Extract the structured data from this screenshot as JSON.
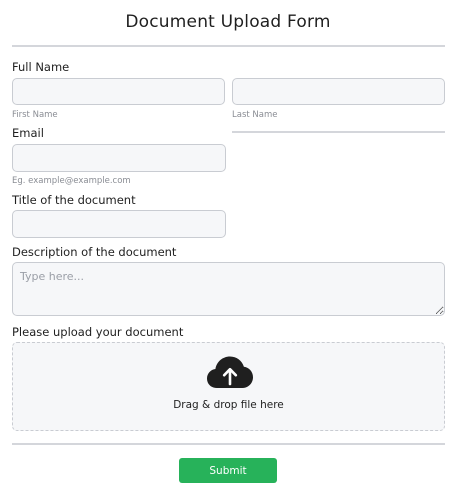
{
  "form": {
    "title": "Document Upload Form",
    "full_name": {
      "label": "Full Name",
      "first_value": "",
      "first_hint": "First Name",
      "last_value": "",
      "last_hint": "Last Name"
    },
    "email": {
      "label": "Email",
      "value": "",
      "hint": "Eg. example@example.com"
    },
    "doc_title": {
      "label": "Title of the document",
      "value": ""
    },
    "description": {
      "label": "Description of the document",
      "placeholder": "Type here..."
    },
    "upload": {
      "label": "Please upload your document",
      "icon": "cloud-upload-icon",
      "drop_text": "Drag & drop file here"
    },
    "submit_label": "Submit",
    "colors": {
      "submit": "#27b25a",
      "field_bg": "#f6f7f9",
      "field_border": "#c9ccd2",
      "icon": "#1f1f1f"
    }
  }
}
